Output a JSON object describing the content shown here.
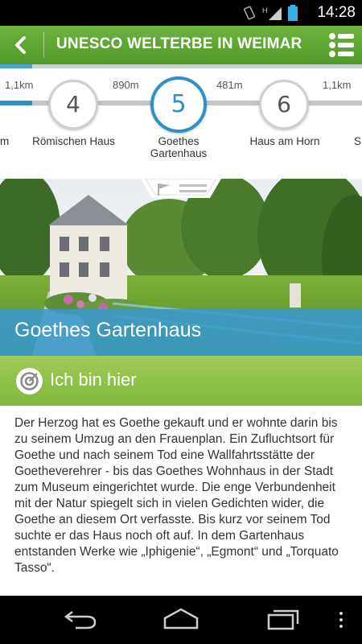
{
  "status": {
    "time": "14:28"
  },
  "appbar": {
    "title": "UNESCO WELTERBE IN WEIMAR"
  },
  "stepper": {
    "distances": [
      "1,1km",
      "890m",
      "481m",
      "1,1km"
    ],
    "stops": [
      {
        "number": "4",
        "label": "Römischen Haus"
      },
      {
        "number": "5",
        "label": "Goethes Gartenhaus",
        "active": true
      },
      {
        "number": "6",
        "label": "Haus am Horn"
      }
    ],
    "edge_left_label": "m",
    "edge_right_label": "S"
  },
  "place": {
    "title": "Goethes Gartenhaus",
    "here_label": "Ich bin hier",
    "description": "Der Herzog hat es Goethe gekauft und er wohnte darin bis zu seinem Umzug an den Frauenplan. Ein Zufluchtsort für Goethe und nach seinem Tod eine Wallfahrtsstätte der Goetheverehrer - bis das Goethes Wohnhaus in der Stadt zum Museum eingerichtet wurde. Die enge Verbundenheit mit der Natur spiegelt sich in vielen Gedichten wider, die Goethe an diesem Ort verfasste. Bis kurz vor seinem Tod suchte er das Haus noch oft auf. In dem Gartenhaus entstanden Werke wie „Iphigenie“, „Egmont“ und „Torquato Tasso“."
  },
  "colors": {
    "green": "#6db33f",
    "blue": "#2f8fc8",
    "light_green": "#9fcb5a"
  }
}
